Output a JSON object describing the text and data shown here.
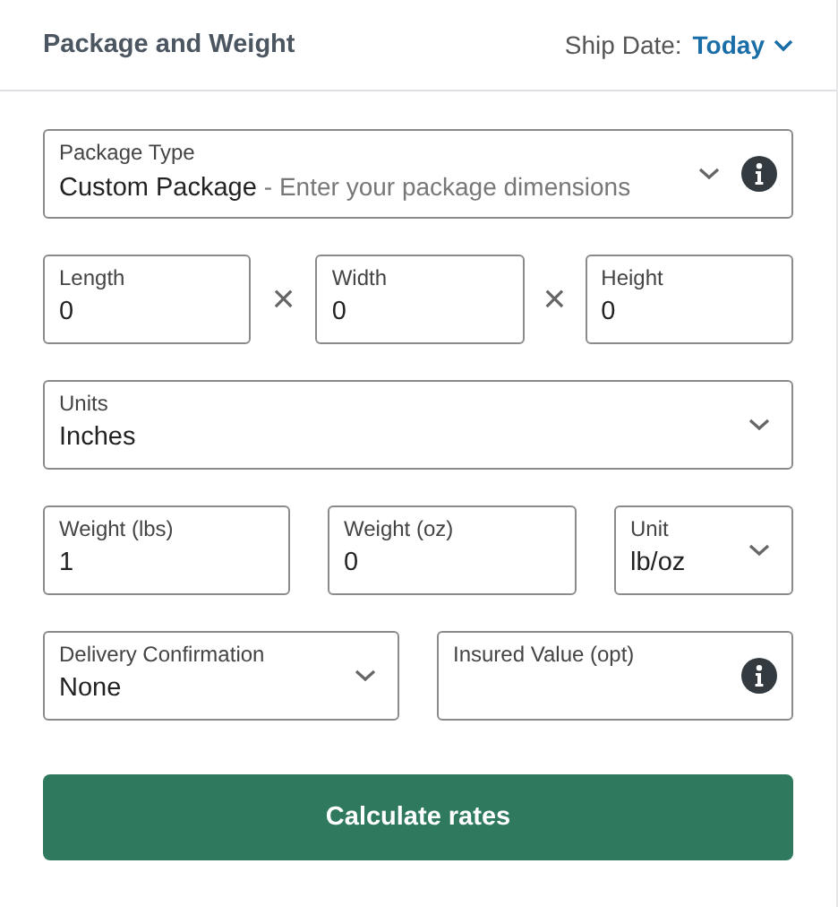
{
  "header": {
    "title": "Package and Weight",
    "ship_date_label": "Ship Date:",
    "ship_date_value": "Today"
  },
  "rows": [
    {
      "items": [
        {
          "kind": "select",
          "label": "Package Type",
          "value": "Custom Package",
          "hint": "- Enter your package dimensions",
          "info": true
        }
      ]
    },
    {
      "items": [
        {
          "kind": "input",
          "label": "Length",
          "value": "0"
        },
        {
          "kind": "separator",
          "symbol": "×"
        },
        {
          "kind": "input",
          "label": "Width",
          "value": "0"
        },
        {
          "kind": "separator",
          "symbol": "×"
        },
        {
          "kind": "input",
          "label": "Height",
          "value": "0"
        }
      ]
    },
    {
      "items": [
        {
          "kind": "select",
          "label": "Units",
          "value": "Inches"
        }
      ]
    },
    {
      "items": [
        {
          "kind": "input",
          "label": "Weight (lbs)",
          "value": "1"
        },
        {
          "kind": "input",
          "label": "Weight (oz)",
          "value": "0"
        },
        {
          "kind": "select",
          "label": "Unit",
          "value": "lb/oz"
        }
      ]
    },
    {
      "items": [
        {
          "kind": "select",
          "label": "Delivery Confirmation",
          "value": "None"
        },
        {
          "kind": "input",
          "label": "Insured Value (opt)",
          "info": true
        }
      ]
    }
  ],
  "button": "Calculate rates"
}
